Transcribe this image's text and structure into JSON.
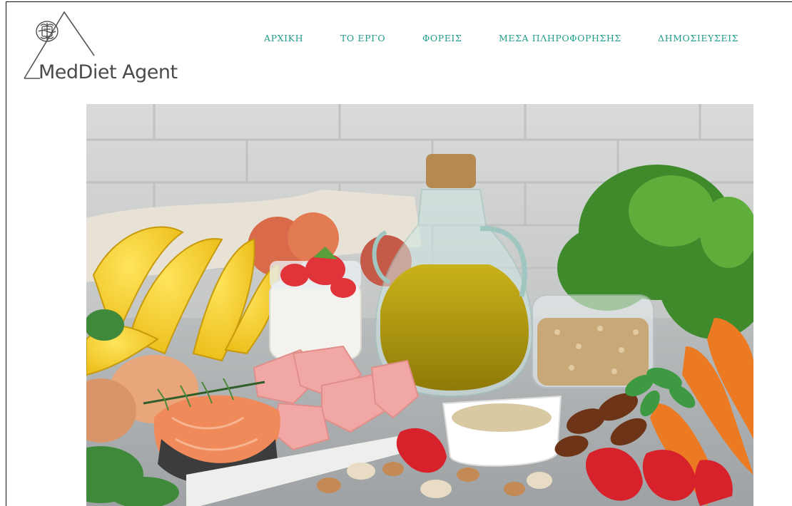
{
  "brand": {
    "name": "MedDiet Agent",
    "accent": "#1f9d8b"
  },
  "nav": {
    "items": [
      {
        "label": "ΑΡΧΙΚΗ"
      },
      {
        "label": "ΤΟ ΕΡΓΟ"
      },
      {
        "label": "ΦΟΡΕΙΣ"
      },
      {
        "label": "ΜΕΣΑ ΠΛΗΡΟΦΟΡΗΣΗΣ"
      },
      {
        "label": "ΔΗΜΟΣΙΕΥΣΕΙΣ"
      }
    ]
  },
  "hero": {
    "image": "mediterranean-diet-foods-photo",
    "items": [
      "bananas",
      "yogurt-with-strawberries",
      "olive-oil-jug",
      "oats-jar",
      "carrots",
      "fresh-greens",
      "salmon-steak",
      "chicken-pieces",
      "quinoa-bowl",
      "strawberries",
      "dates",
      "nuts",
      "eggs",
      "peaches"
    ]
  }
}
